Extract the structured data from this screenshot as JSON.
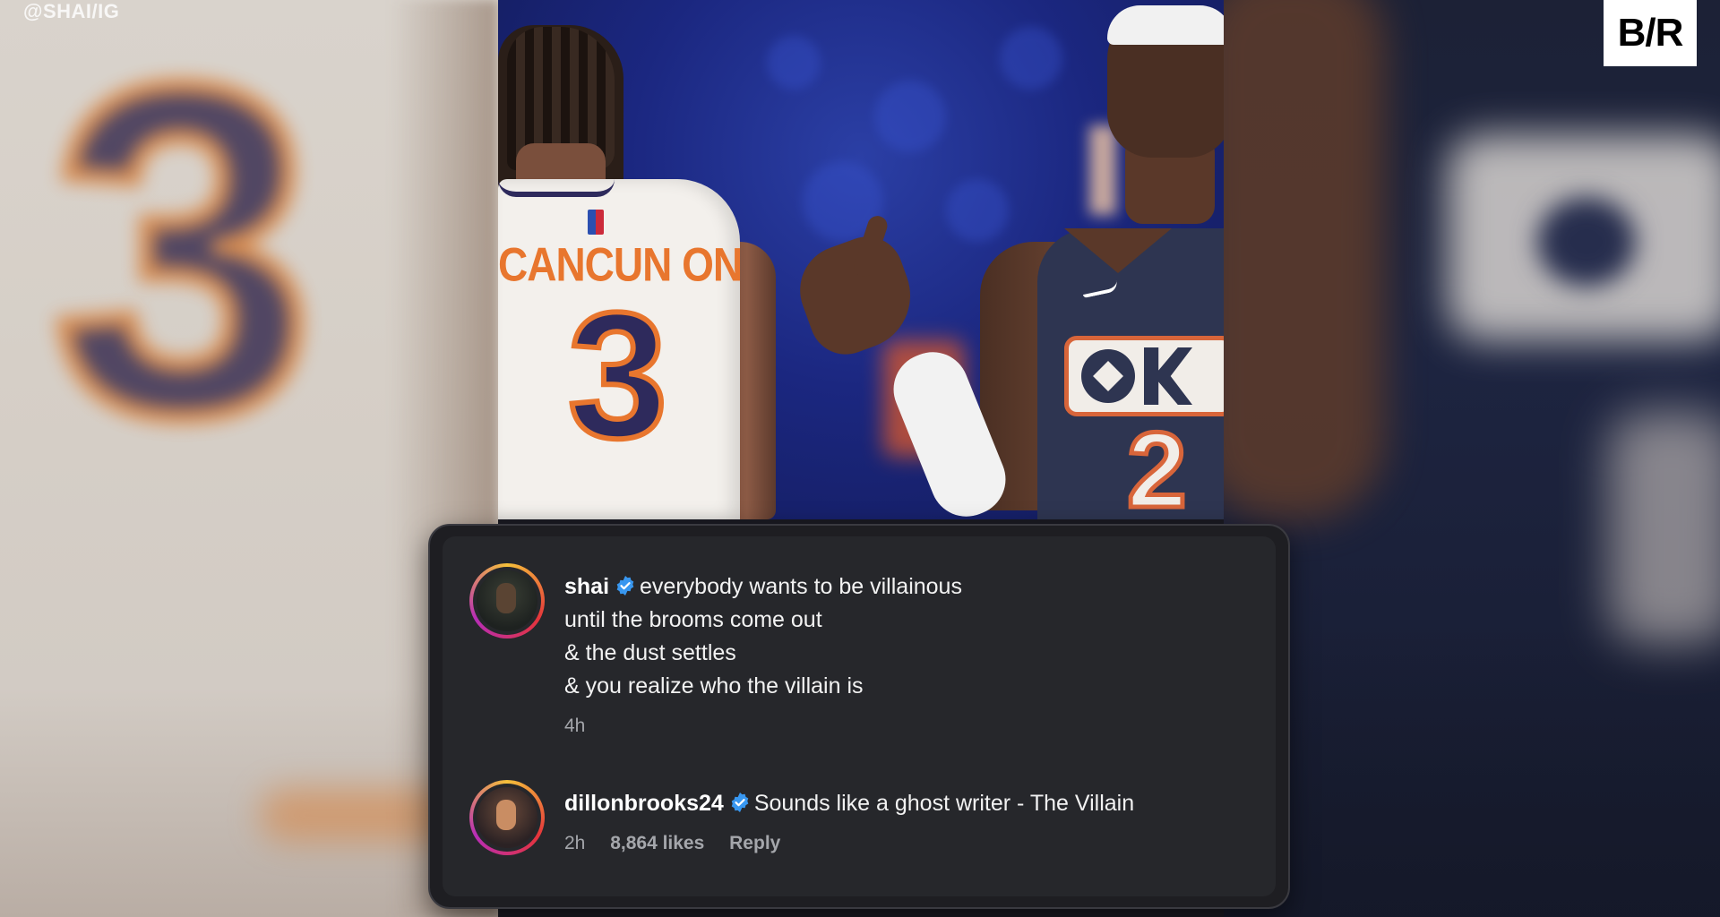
{
  "watermark": "@SHAI/IG",
  "brand_logo_text": "B/R",
  "photo": {
    "left_jersey_name": "CANCUN ON",
    "left_jersey_number": "3",
    "right_jersey_number": "2"
  },
  "comments": [
    {
      "username": "shai",
      "verified": true,
      "lines": [
        "everybody wants to be villainous",
        "until the brooms come out",
        "& the dust settles",
        "& you realize who the villain is"
      ],
      "time": "4h"
    },
    {
      "username": "dillonbrooks24",
      "verified": true,
      "lines": [
        "Sounds like a ghost writer - The Villain"
      ],
      "time": "2h",
      "likes": "8,864 likes",
      "reply_label": "Reply"
    }
  ],
  "colors": {
    "verified_badge": "#3897f0",
    "card_bg": "#26272b",
    "meta_text": "#a4a6ab"
  },
  "icons": {
    "verified": "verified-badge-icon",
    "avatar": "avatar-icon"
  }
}
